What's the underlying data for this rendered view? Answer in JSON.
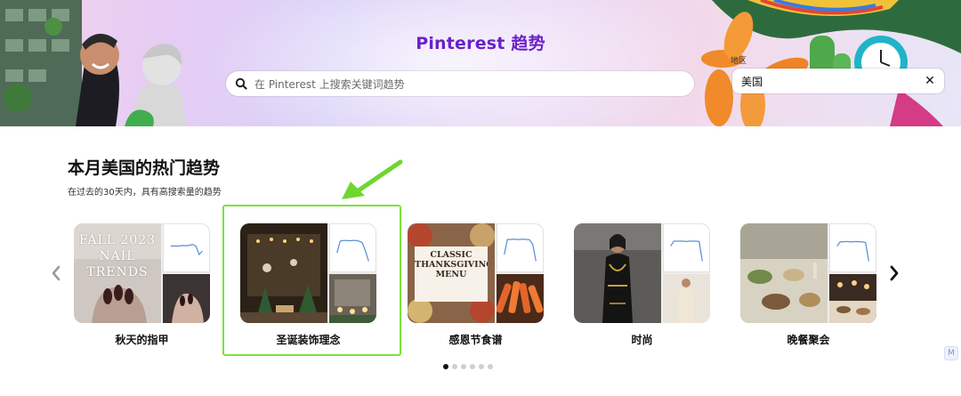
{
  "hero": {
    "title": "Pinterest 趋势",
    "search_placeholder": "在 Pinterest 上搜索关键词趋势",
    "region_label": "地区",
    "region_value": "美国",
    "region_clear_glyph": "✕"
  },
  "section": {
    "title": "本月美国的热门趋势",
    "subtitle": "在过去的30天内，具有高搜索量的趋势"
  },
  "cards": [
    {
      "label": "秋天的指甲",
      "main_caption": "FALL 2023 NAIL TRENDS",
      "spark": [
        0.55,
        0.56,
        0.55,
        0.56,
        0.57,
        0.56,
        0.58,
        0.6,
        0.55,
        0.3,
        0.4
      ]
    },
    {
      "label": "圣诞装饰理念",
      "main_caption": "",
      "spark": [
        0.35,
        0.7,
        0.72,
        0.72,
        0.71,
        0.72,
        0.72,
        0.7,
        0.65,
        0.4,
        0.1
      ]
    },
    {
      "label": "感恩节食谱",
      "main_caption": "CLASSIC THANKSGIVING MENU",
      "spark": [
        0.3,
        0.75,
        0.75,
        0.76,
        0.75,
        0.75,
        0.76,
        0.75,
        0.74,
        0.6,
        0.1
      ]
    },
    {
      "label": "时尚",
      "main_caption": "",
      "spark": [
        0.55,
        0.7,
        0.7,
        0.7,
        0.7,
        0.69,
        0.7,
        0.7,
        0.7,
        0.69,
        0.1
      ]
    },
    {
      "label": "晚餐聚会",
      "main_caption": "",
      "spark": [
        0.55,
        0.68,
        0.68,
        0.69,
        0.68,
        0.68,
        0.69,
        0.68,
        0.68,
        0.66,
        0.1
      ]
    }
  ],
  "carousel": {
    "dot_count": 6,
    "active_dot": 0
  },
  "corner_widget_text": "M",
  "colors": {
    "accent": "#6b21c8",
    "highlight": "#7be33a",
    "sparkline": "#5b8fd8"
  }
}
